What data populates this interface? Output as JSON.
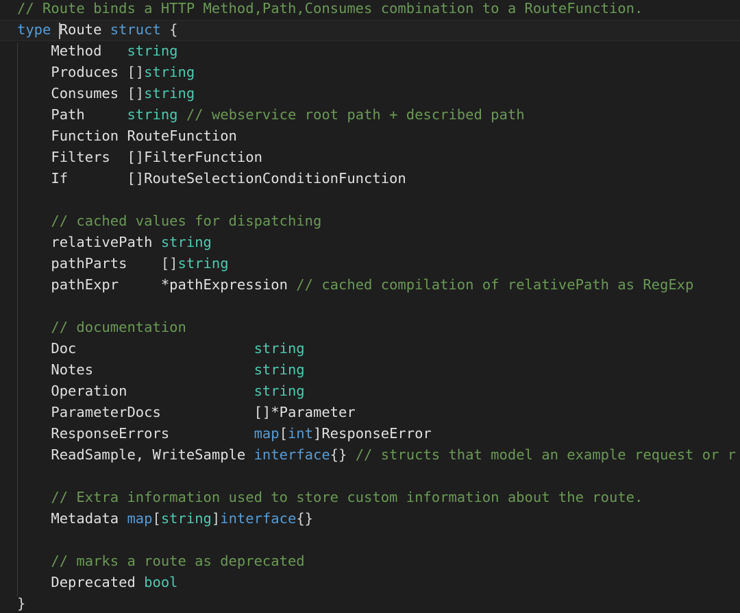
{
  "editor": {
    "language": "go",
    "colors": {
      "background": "#1e1e1e",
      "comment": "#6a9955",
      "keyword": "#569cd6",
      "type": "#4ec9b0",
      "text": "#d4d4d4"
    },
    "lines": [
      [
        {
          "t": "// Route binds a HTTP Method,Path,Consumes combination to a RouteFunction.",
          "k": "comment"
        }
      ],
      [
        {
          "t": "type",
          "k": "keyword"
        },
        {
          "t": " Route ",
          "k": "field"
        },
        {
          "t": "struct",
          "k": "keyword"
        },
        {
          "t": " {",
          "k": "punct"
        }
      ],
      [
        {
          "t": "    Method   ",
          "k": "field"
        },
        {
          "t": "string",
          "k": "type"
        }
      ],
      [
        {
          "t": "    Produces ",
          "k": "field"
        },
        {
          "t": "[]",
          "k": "punct"
        },
        {
          "t": "string",
          "k": "type"
        }
      ],
      [
        {
          "t": "    Consumes ",
          "k": "field"
        },
        {
          "t": "[]",
          "k": "punct"
        },
        {
          "t": "string",
          "k": "type"
        }
      ],
      [
        {
          "t": "    Path     ",
          "k": "field"
        },
        {
          "t": "string",
          "k": "type"
        },
        {
          "t": " // webservice root path + described path",
          "k": "comment"
        }
      ],
      [
        {
          "t": "    Function RouteFunction",
          "k": "field"
        }
      ],
      [
        {
          "t": "    Filters  []FilterFunction",
          "k": "field"
        }
      ],
      [
        {
          "t": "    If       []RouteSelectionConditionFunction",
          "k": "field"
        }
      ],
      [],
      [
        {
          "t": "    // cached values for dispatching",
          "k": "comment"
        }
      ],
      [
        {
          "t": "    relativePath ",
          "k": "field"
        },
        {
          "t": "string",
          "k": "type"
        }
      ],
      [
        {
          "t": "    pathParts    ",
          "k": "field"
        },
        {
          "t": "[]",
          "k": "punct"
        },
        {
          "t": "string",
          "k": "type"
        }
      ],
      [
        {
          "t": "    pathExpr     *pathExpression",
          "k": "field"
        },
        {
          "t": " // cached compilation of relativePath as RegExp",
          "k": "comment"
        }
      ],
      [],
      [
        {
          "t": "    // documentation",
          "k": "comment"
        }
      ],
      [
        {
          "t": "    Doc                     ",
          "k": "field"
        },
        {
          "t": "string",
          "k": "type"
        }
      ],
      [
        {
          "t": "    Notes                   ",
          "k": "field"
        },
        {
          "t": "string",
          "k": "type"
        }
      ],
      [
        {
          "t": "    Operation               ",
          "k": "field"
        },
        {
          "t": "string",
          "k": "type"
        }
      ],
      [
        {
          "t": "    ParameterDocs           []*Parameter",
          "k": "field"
        }
      ],
      [
        {
          "t": "    ResponseErrors          ",
          "k": "field"
        },
        {
          "t": "map",
          "k": "keyword"
        },
        {
          "t": "[",
          "k": "punct"
        },
        {
          "t": "int",
          "k": "keyword"
        },
        {
          "t": "]ResponseError",
          "k": "field"
        }
      ],
      [
        {
          "t": "    ReadSample, WriteSample ",
          "k": "field"
        },
        {
          "t": "interface",
          "k": "keyword"
        },
        {
          "t": "{}",
          "k": "punct"
        },
        {
          "t": " // structs that model an example request or r",
          "k": "comment"
        }
      ],
      [],
      [
        {
          "t": "    // Extra information used to store custom information about the route.",
          "k": "comment"
        }
      ],
      [
        {
          "t": "    Metadata ",
          "k": "field"
        },
        {
          "t": "map",
          "k": "keyword"
        },
        {
          "t": "[",
          "k": "punct"
        },
        {
          "t": "string",
          "k": "type"
        },
        {
          "t": "]",
          "k": "punct"
        },
        {
          "t": "interface",
          "k": "keyword"
        },
        {
          "t": "{}",
          "k": "punct"
        }
      ],
      [],
      [
        {
          "t": "    // marks a route as deprecated",
          "k": "comment"
        }
      ],
      [
        {
          "t": "    Deprecated ",
          "k": "field"
        },
        {
          "t": "bool",
          "k": "type"
        }
      ],
      [
        {
          "t": "}",
          "k": "punct"
        }
      ]
    ]
  }
}
